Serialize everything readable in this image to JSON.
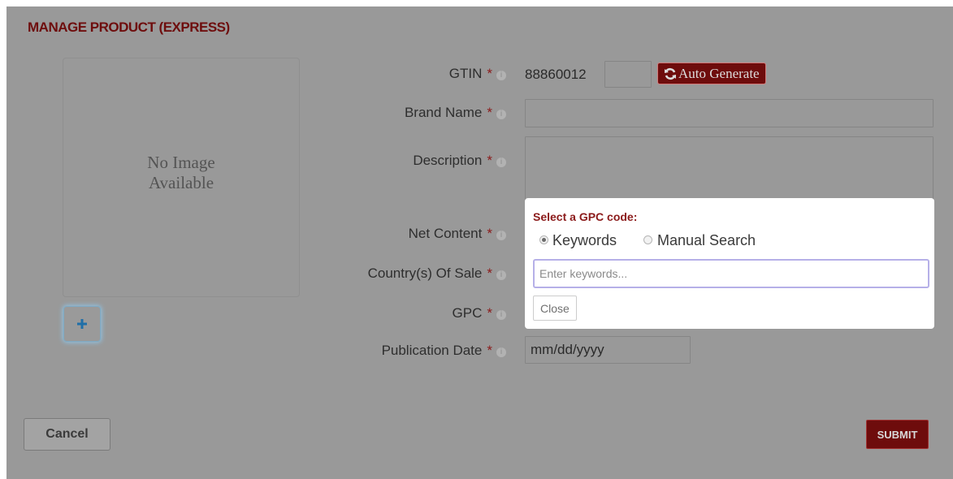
{
  "page": {
    "title": "MANAGE PRODUCT (EXPRESS)"
  },
  "image_panel": {
    "no_image_line1": "No Image",
    "no_image_line2": "Available",
    "add_button_icon": "plus-icon"
  },
  "form": {
    "required_marker": "*",
    "info_icon": "info-icon",
    "gtin": {
      "label": "GTIN",
      "prefix": "88860012",
      "value": "",
      "auto_generate_label": "Auto Generate",
      "auto_generate_icon": "refresh-icon"
    },
    "brand_name": {
      "label": "Brand Name",
      "value": ""
    },
    "description": {
      "label": "Description",
      "value": ""
    },
    "net_content": {
      "label": "Net Content"
    },
    "countries_of_sale": {
      "label": "Country(s) Of Sale"
    },
    "gpc": {
      "label": "GPC"
    },
    "publication_date": {
      "label": "Publication Date",
      "value": "mm/dd/yyyy"
    }
  },
  "gpc_popup": {
    "title": "Select a GPC code:",
    "options": [
      {
        "label": "Keywords",
        "selected": true
      },
      {
        "label": "Manual Search",
        "selected": false
      }
    ],
    "search_placeholder": "Enter keywords...",
    "close_label": "Close"
  },
  "actions": {
    "cancel_label": "Cancel",
    "submit_label": "SUBMIT"
  },
  "colors": {
    "brand_red": "#6e0c0c",
    "overlay_gray": "#999999",
    "required_red": "#8b1a1a"
  }
}
